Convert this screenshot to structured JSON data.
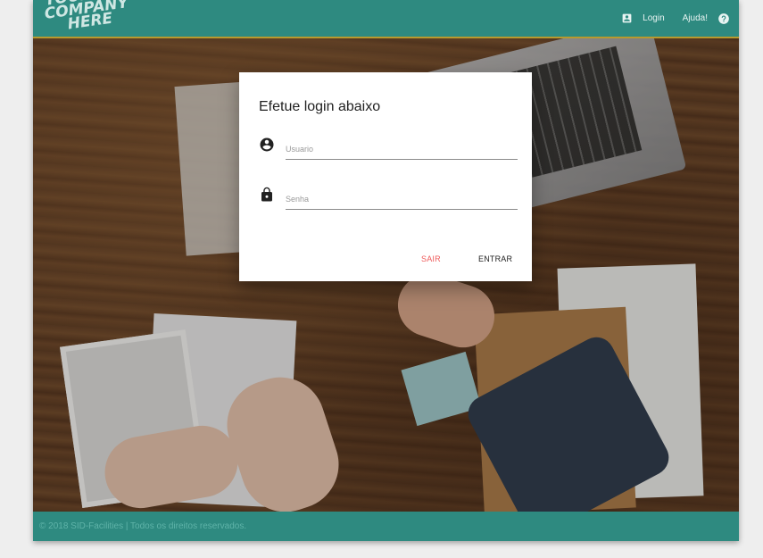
{
  "header": {
    "logo_lines": [
      "YOUR",
      "COMPANY",
      "HERE"
    ],
    "login_label": "Login",
    "help_label": "Ajuda!",
    "icons": {
      "login": "account-box-icon",
      "help": "help-circle-icon"
    }
  },
  "dialog": {
    "title": "Efetue login abaixo",
    "username": {
      "placeholder": "Usuario",
      "value": "",
      "icon": "account-circle-icon"
    },
    "password": {
      "placeholder": "Senha",
      "value": "",
      "icon": "lock-icon"
    },
    "cancel_label": "SAIR",
    "submit_label": "ENTRAR"
  },
  "footer": {
    "text": "© 2018 SID-Facilities | Todos os direitos reservados."
  },
  "colors": {
    "primary": "#2e8a80",
    "accent_line": "#b89a2e",
    "cancel": "#ef5b5b",
    "footer_text": "#5fb3a8"
  }
}
